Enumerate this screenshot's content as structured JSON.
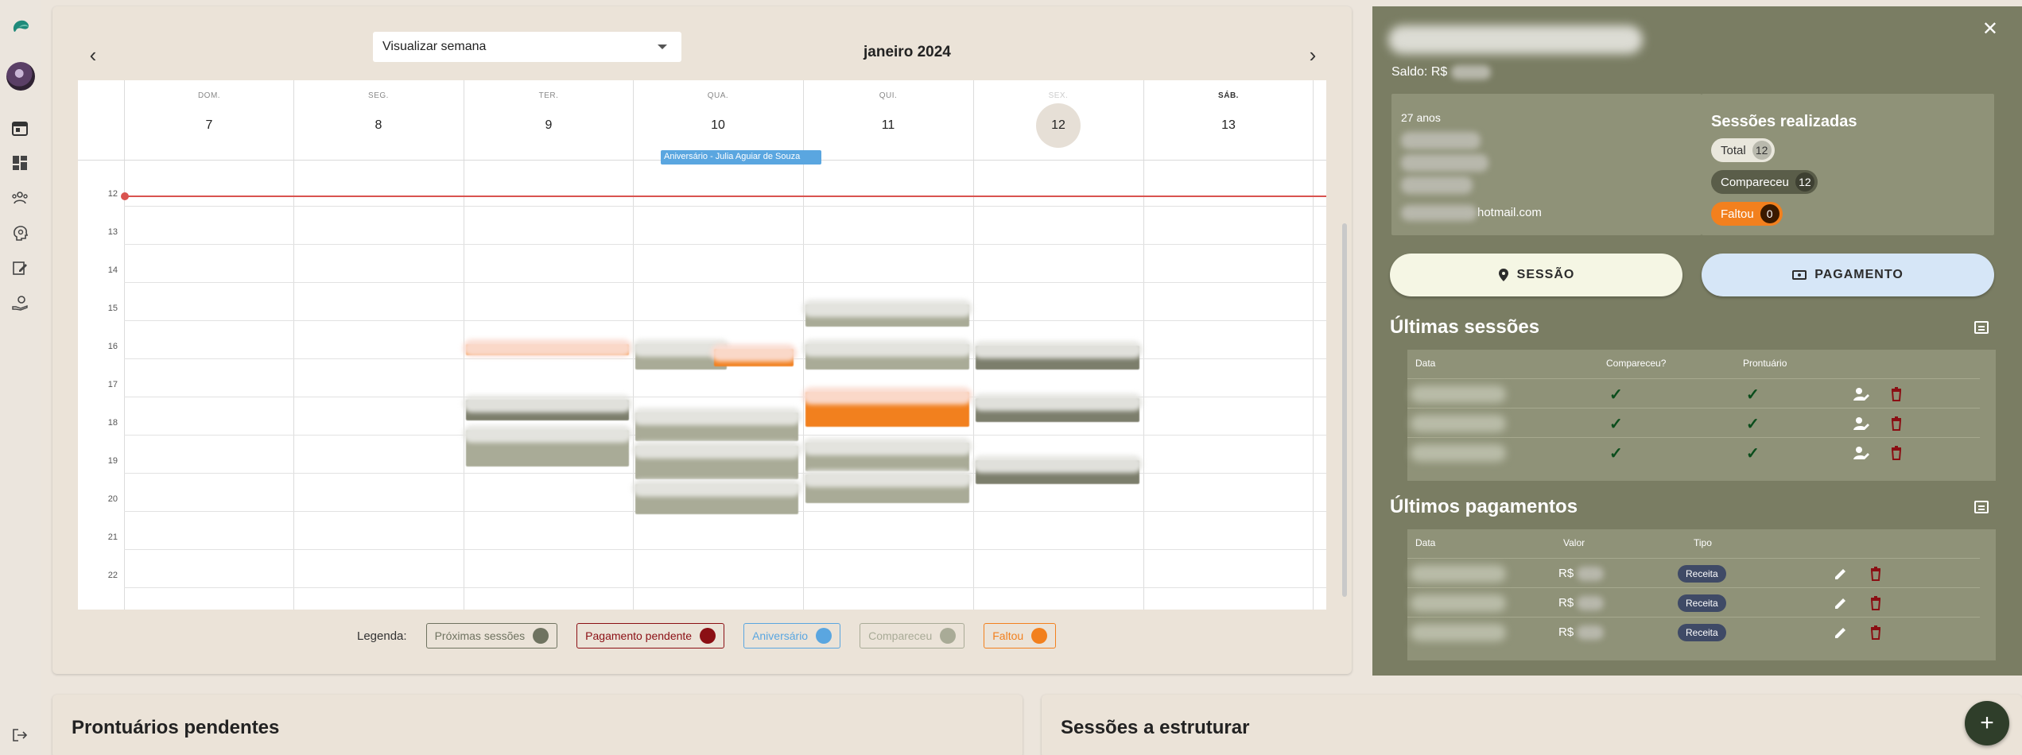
{
  "calendar": {
    "view_select": "Visualizar semana",
    "month_title": "janeiro 2024",
    "days": [
      {
        "name": "DOM.",
        "num": "7"
      },
      {
        "name": "SEG.",
        "num": "8"
      },
      {
        "name": "TER.",
        "num": "9"
      },
      {
        "name": "QUA.",
        "num": "10"
      },
      {
        "name": "QUI.",
        "num": "11"
      },
      {
        "name": "SEX.",
        "num": "12"
      },
      {
        "name": "SÁB.",
        "num": "13"
      }
    ],
    "hours": [
      "12",
      "13",
      "14",
      "15",
      "16",
      "17",
      "18",
      "19",
      "20",
      "21",
      "22"
    ],
    "birthday_event": "Aniversário - Julia Aguiar de Souza"
  },
  "legend": {
    "title": "Legenda:",
    "items": [
      {
        "label": "Próximas sessões",
        "color": "#6f7360"
      },
      {
        "label": "Pagamento pendente",
        "color": "#8b0f14"
      },
      {
        "label": "Aniversário",
        "color": "#5aa6e0"
      },
      {
        "label": "Compareceu",
        "color": "#a9ab97"
      },
      {
        "label": "Faltou",
        "color": "#f2801e"
      }
    ]
  },
  "patient": {
    "saldo_label": "Saldo: R$",
    "age": "27 anos",
    "email_suffix": "hotmail.com",
    "sessions_title": "Sessões realizadas",
    "total_label": "Total",
    "total_count": "12",
    "attended_label": "Compareceu",
    "attended_count": "12",
    "missed_label": "Faltou",
    "missed_count": "0"
  },
  "actions": {
    "session_btn": "SESSÃO",
    "payment_btn": "PAGAMENTO"
  },
  "last_sessions": {
    "title": "Últimas sessões",
    "headers": [
      "Data",
      "Compareceu?",
      "Prontuário"
    ]
  },
  "last_payments": {
    "title": "Últimos pagamentos",
    "headers": [
      "Data",
      "Valor",
      "Tipo"
    ],
    "currency": "R$",
    "type_badge": "Receita"
  },
  "bottom": {
    "pending_records": "Prontuários pendentes",
    "sessions_to_structure": "Sessões a estruturar"
  },
  "fab_label": "+",
  "close_label": "✕"
}
